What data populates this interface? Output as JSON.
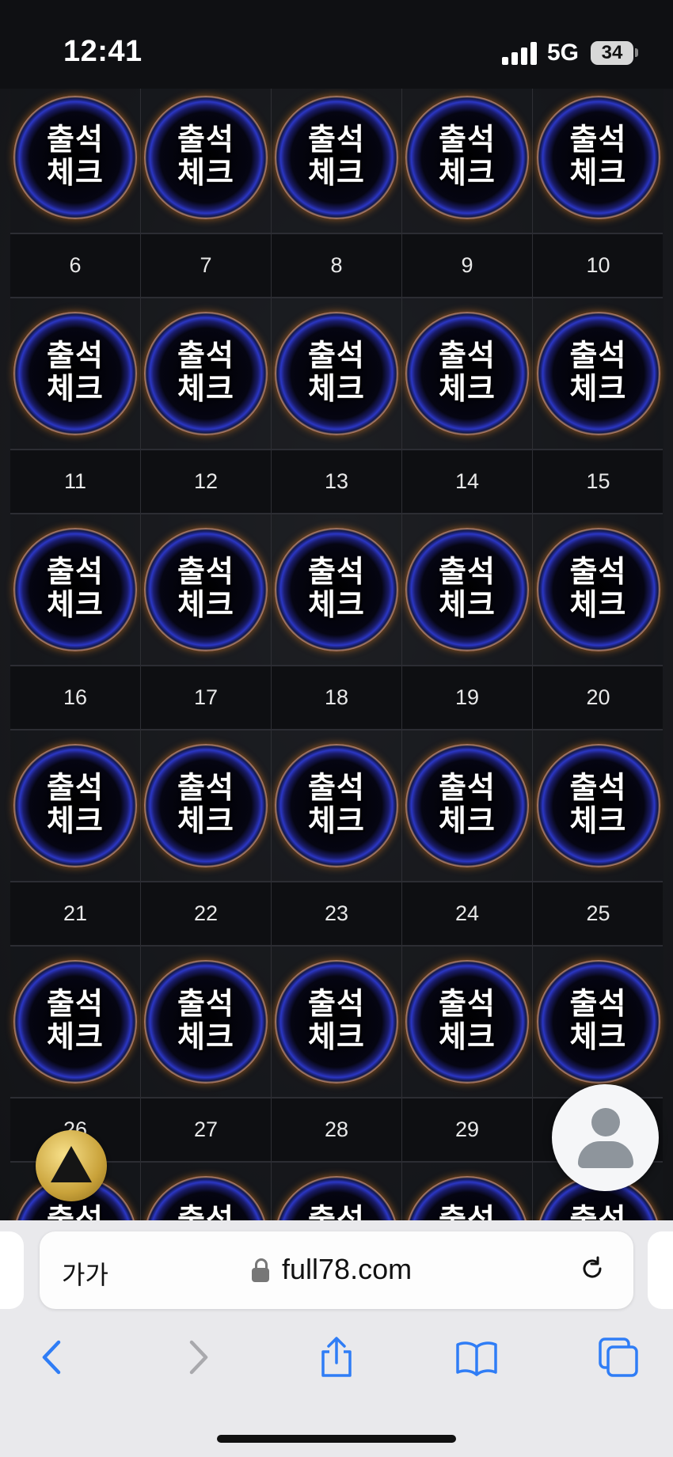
{
  "status_bar": {
    "time": "12:41",
    "network": "5G",
    "battery": "34"
  },
  "calendar": {
    "stamp_text": "출석\n체크",
    "rows": [
      {
        "numbers": [
          "6",
          "7",
          "8",
          "9",
          "10"
        ]
      },
      {
        "numbers": [
          "11",
          "12",
          "13",
          "14",
          "15"
        ]
      },
      {
        "numbers": [
          "16",
          "17",
          "18",
          "19",
          "20"
        ]
      },
      {
        "numbers": [
          "21",
          "22",
          "23",
          "24",
          "25"
        ]
      },
      {
        "numbers": [
          "26",
          "27",
          "28",
          "29",
          ""
        ]
      }
    ]
  },
  "browser": {
    "text_size_label": "가가",
    "url": "full78.com"
  },
  "icons": {
    "back": "chevron-left-icon",
    "forward": "chevron-right-icon",
    "share": "share-icon",
    "bookmarks": "book-icon",
    "tabs": "tabs-icon",
    "scroll_top": "triangle-up-icon",
    "profile": "person-icon"
  },
  "colors": {
    "accent_blue": "#2f7df6",
    "stamp_ring": "#ff9a1f"
  }
}
